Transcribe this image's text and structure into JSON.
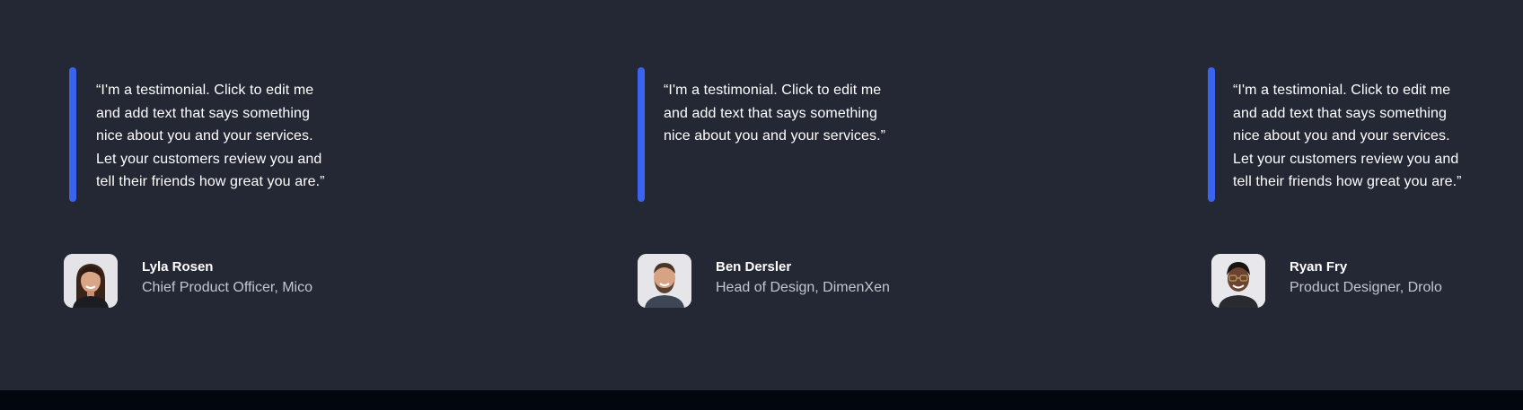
{
  "colors": {
    "background": "#242835",
    "accent": "#3a63f0",
    "footer": "#02060f",
    "text_primary": "#ffffff",
    "text_secondary": "#c3c6cf"
  },
  "testimonials": [
    {
      "quote_lines": [
        "“I'm a testimonial. Click to edit me",
        "and add text that says something",
        "nice about you and your services.",
        "Let your customers review you and",
        "tell their friends how great you are.”"
      ],
      "name": "Lyla Rosen",
      "role": "Chief Product Officer, Mico",
      "avatar_icon": "woman-avatar"
    },
    {
      "quote_lines": [
        "“I'm a testimonial. Click to edit me",
        "and add text that says something",
        "nice about you and your services.”"
      ],
      "name": "Ben Dersler",
      "role": "Head of Design, DimenXen",
      "avatar_icon": "man-avatar"
    },
    {
      "quote_lines": [
        "“I'm a testimonial. Click to edit me",
        "and add text that says something",
        "nice about you and your services.",
        "Let your customers review you and",
        "tell their friends how great you are.”"
      ],
      "name": "Ryan Fry",
      "role": "Product Designer, Drolo",
      "avatar_icon": "man-glasses-avatar"
    }
  ]
}
